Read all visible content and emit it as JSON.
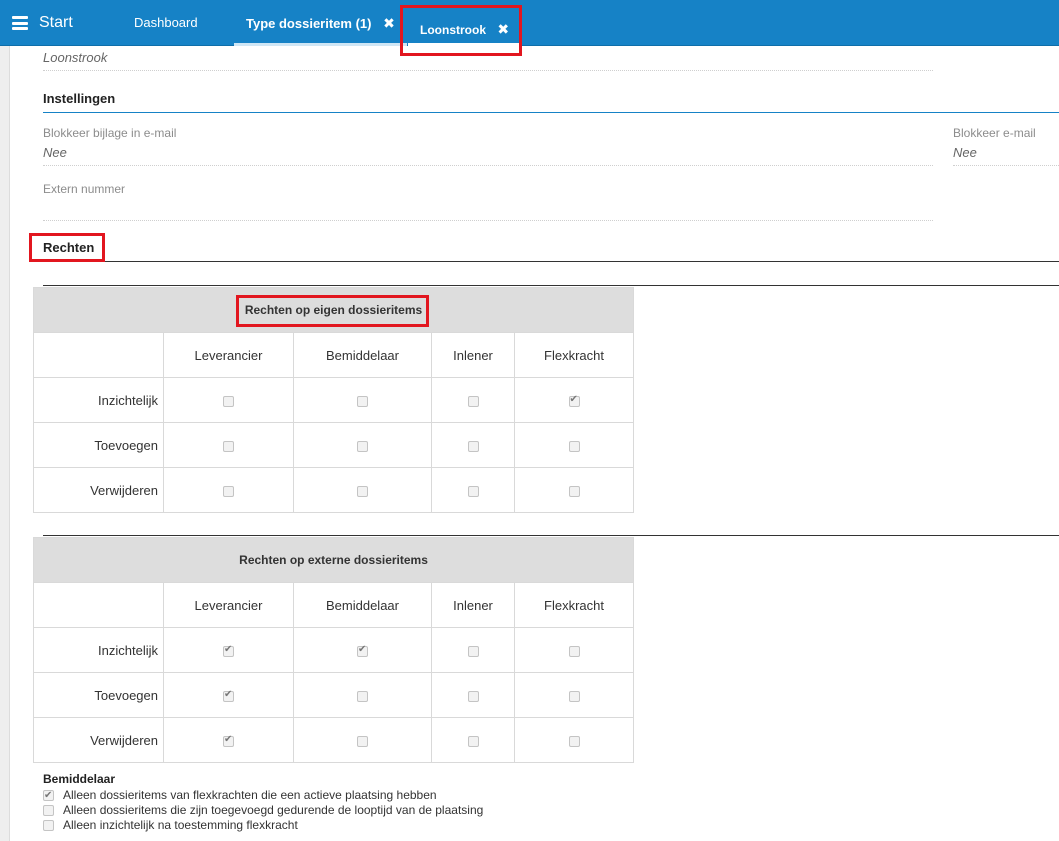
{
  "topbar": {
    "menu_label": "Start",
    "tabs": [
      {
        "label": "Dashboard"
      },
      {
        "label": "Type dossieritem (1)",
        "close": "✖"
      },
      {
        "label": "Loonstrook",
        "close": "✖"
      }
    ]
  },
  "details": {
    "name_value": "Loonstrook",
    "instellingen_title": "Instellingen",
    "blokkeer_bijlage_label": "Blokkeer bijlage in e-mail",
    "blokkeer_bijlage_value": "Nee",
    "blokkeer_email_label": "Blokkeer e-mail",
    "blokkeer_email_value": "Nee",
    "extern_nummer_label": "Extern nummer",
    "extern_nummer_value": ""
  },
  "rechten": {
    "title": "Rechten",
    "columns": [
      "Leverancier",
      "Bemiddelaar",
      "Inlener",
      "Flexkracht"
    ],
    "tables": [
      {
        "title": "Rechten op eigen dossieritems",
        "rows": [
          {
            "label": "Inzichtelijk",
            "values": [
              false,
              false,
              false,
              true
            ]
          },
          {
            "label": "Toevoegen",
            "values": [
              false,
              false,
              false,
              false
            ]
          },
          {
            "label": "Verwijderen",
            "values": [
              false,
              false,
              false,
              false
            ]
          }
        ]
      },
      {
        "title": "Rechten op externe dossieritems",
        "rows": [
          {
            "label": "Inzichtelijk",
            "values": [
              true,
              true,
              false,
              false
            ]
          },
          {
            "label": "Toevoegen",
            "values": [
              true,
              false,
              false,
              false
            ]
          },
          {
            "label": "Verwijderen",
            "values": [
              true,
              false,
              false,
              false
            ]
          }
        ]
      }
    ]
  },
  "bemiddelaar": {
    "title": "Bemiddelaar",
    "options": [
      {
        "label": "Alleen dossieritems van flexkrachten die een actieve plaatsing hebben",
        "checked": true
      },
      {
        "label": "Alleen dossieritems die zijn toegevoegd gedurende de looptijd van de plaatsing",
        "checked": false
      },
      {
        "label": "Alleen inzichtelijk na toestemming flexkracht",
        "checked": false
      }
    ]
  }
}
